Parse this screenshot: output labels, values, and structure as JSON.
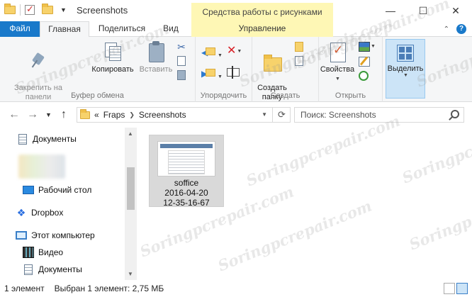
{
  "window": {
    "title": "Screenshots",
    "context_title": "Средства работы с рисунками",
    "controls": {
      "minimize": "—",
      "maximize": "☐",
      "close": "✕"
    }
  },
  "tabs": [
    {
      "label": "Файл"
    },
    {
      "label": "Главная"
    },
    {
      "label": "Поделиться"
    },
    {
      "label": "Вид"
    },
    {
      "label": "Управление"
    }
  ],
  "ribbon": {
    "clipboard": {
      "label": "Буфер обмена",
      "pin": "Закрепить на панели\nбыстрого доступа",
      "copy": "Копировать",
      "paste": "Вставить"
    },
    "organize": {
      "label": "Упорядочить"
    },
    "create": {
      "label": "Создать",
      "new_folder": "Создать\nпапку"
    },
    "open": {
      "label": "Открыть",
      "properties": "Свойства"
    },
    "select": {
      "label": "Выделить"
    }
  },
  "address": {
    "overflow": "«",
    "crumbs": [
      "Fraps",
      "Screenshots"
    ],
    "search_placeholder": "Поиск: Screenshots"
  },
  "nav": {
    "items": [
      {
        "label": "Документы",
        "icon": "documents-icon"
      },
      {
        "label": "Рабочий стол",
        "icon": "desktop-icon"
      },
      {
        "label": "Dropbox",
        "icon": "dropbox-icon"
      },
      {
        "label": "Этот компьютер",
        "icon": "computer-icon"
      },
      {
        "label": "Видео",
        "icon": "video-icon"
      },
      {
        "label": "Документы",
        "icon": "documents-icon"
      }
    ]
  },
  "files": [
    {
      "name": "soffice",
      "line2": "2016-04-20",
      "line3": "12-35-16-67"
    }
  ],
  "status": {
    "count": "1 элемент",
    "selected": "Выбран 1 элемент: 2,75 МБ"
  },
  "watermark": "Soringpcrepair.com",
  "colors": {
    "accent": "#1979ca",
    "context": "#fef7b5",
    "selection": "#cce4f7"
  }
}
